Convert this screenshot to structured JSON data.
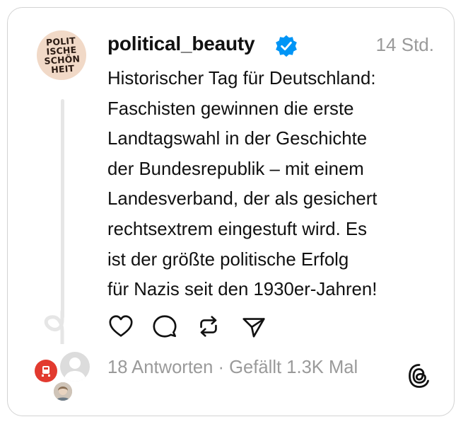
{
  "post": {
    "avatar_text": [
      "POLIT",
      "ISCHE",
      "SCHÖN",
      "HEIT"
    ],
    "username": "political_beauty",
    "verified": true,
    "time": "14 Std.",
    "lines": [
      "Historischer Tag für Deutschland:",
      "Faschisten gewinnen die erste",
      "Landtagswahl in der Geschichte",
      "der Bundesrepublik – mit einem",
      "Landesverband, der als gesichert",
      "rechtsextrem eingestuft wird. Es",
      "ist der größte politische Erfolg",
      "für Nazis seit den 1930er-Jahren!"
    ]
  },
  "actions": {
    "like_icon": "heart-icon",
    "reply_icon": "comment-icon",
    "repost_icon": "repost-icon",
    "share_icon": "send-icon"
  },
  "stats": {
    "summary": "18 Antworten · Gefällt 1.3K Mal"
  },
  "colors": {
    "text": "#111111",
    "muted": "#9a9a9a",
    "verified": "#0095f6",
    "border": "#d3d3d3",
    "thread_line": "#e6e6e6"
  }
}
